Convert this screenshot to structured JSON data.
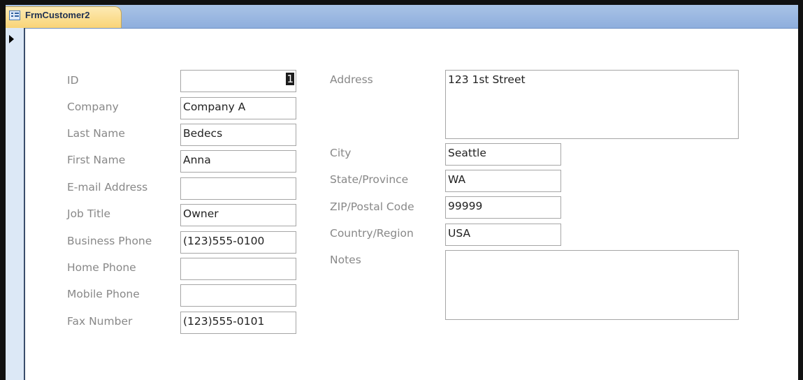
{
  "window": {
    "tab_title": "FrmCustomer2",
    "tab_icon": "form-icon",
    "record_selector_icon": "current-record-arrow-icon"
  },
  "form": {
    "left_fields": [
      {
        "label": "ID",
        "value": "1"
      },
      {
        "label": "Company",
        "value": "Company A"
      },
      {
        "label": "Last Name",
        "value": "Bedecs"
      },
      {
        "label": "First Name",
        "value": "Anna"
      },
      {
        "label": "E-mail Address",
        "value": ""
      },
      {
        "label": "Job Title",
        "value": "Owner"
      },
      {
        "label": "Business Phone",
        "value": "(123)555-0100"
      },
      {
        "label": "Home Phone",
        "value": ""
      },
      {
        "label": "Mobile Phone",
        "value": ""
      },
      {
        "label": "Fax Number",
        "value": "(123)555-0101"
      }
    ],
    "right_fields": [
      {
        "label": "Address",
        "value": "123 1st Street"
      },
      {
        "label": "City",
        "value": "Seattle"
      },
      {
        "label": "State/Province",
        "value": "WA"
      },
      {
        "label": "ZIP/Postal Code",
        "value": "99999"
      },
      {
        "label": "Country/Region",
        "value": "USA"
      },
      {
        "label": "Notes",
        "value": ""
      }
    ]
  },
  "colors": {
    "tab_strip": "#a9c3e6",
    "active_tab": "#f9d477",
    "label_text": "#888888",
    "field_border": "#a6a6a6"
  }
}
